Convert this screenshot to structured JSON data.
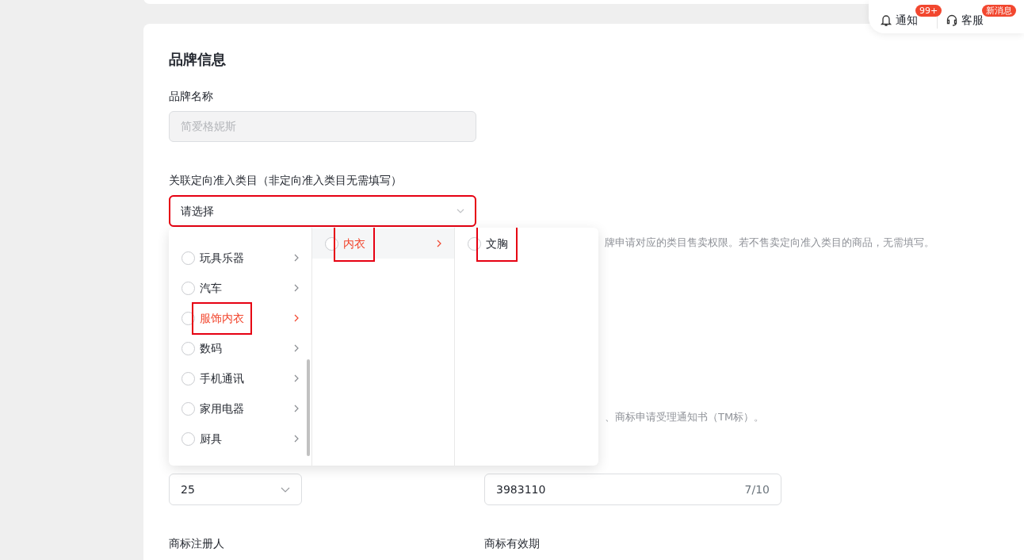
{
  "header_actions": [
    {
      "kind": "bell",
      "label": "通知",
      "badge": "99+"
    },
    {
      "kind": "headset",
      "label": "客服",
      "badge": "新消息"
    }
  ],
  "section": {
    "title": "品牌信息",
    "brand_name": {
      "label": "品牌名称",
      "value": "简爱格妮斯",
      "disabled": true
    },
    "category": {
      "label": "关联定向准入类目（非定向准入类目无需填写）",
      "placeholder": "请选择",
      "focused": true,
      "annotated": true
    },
    "cascader": {
      "columns": [
        {
          "items": [
            {
              "label": "玩具乐器",
              "selected": false,
              "expandable": true,
              "annotated": false
            },
            {
              "label": "汽车",
              "selected": false,
              "expandable": true,
              "annotated": false
            },
            {
              "label": "服饰内衣",
              "selected": true,
              "expandable": true,
              "annotated": true
            },
            {
              "label": "数码",
              "selected": false,
              "expandable": true,
              "annotated": false
            },
            {
              "label": "手机通讯",
              "selected": false,
              "expandable": true,
              "annotated": false
            },
            {
              "label": "家用电器",
              "selected": false,
              "expandable": true,
              "annotated": false
            },
            {
              "label": "厨具",
              "selected": false,
              "expandable": true,
              "annotated": false
            }
          ]
        },
        {
          "items": [
            {
              "label": "内衣",
              "selected": true,
              "expandable": true,
              "annotated": true
            }
          ]
        },
        {
          "items": [
            {
              "label": "文胸",
              "selected": false,
              "expandable": false,
              "annotated": true
            }
          ]
        }
      ]
    },
    "hints": [
      "牌申请对应的类目售卖权限。若不售卖定向准入类目的商品，无需填写。",
      "、商标申请受理通知书（TM标）。"
    ],
    "trademark_class": {
      "value": "25"
    },
    "trademark_number": {
      "value": "3983110",
      "counter": "7/10"
    },
    "labels": [
      "商标注册人",
      "商标有效期"
    ]
  }
}
